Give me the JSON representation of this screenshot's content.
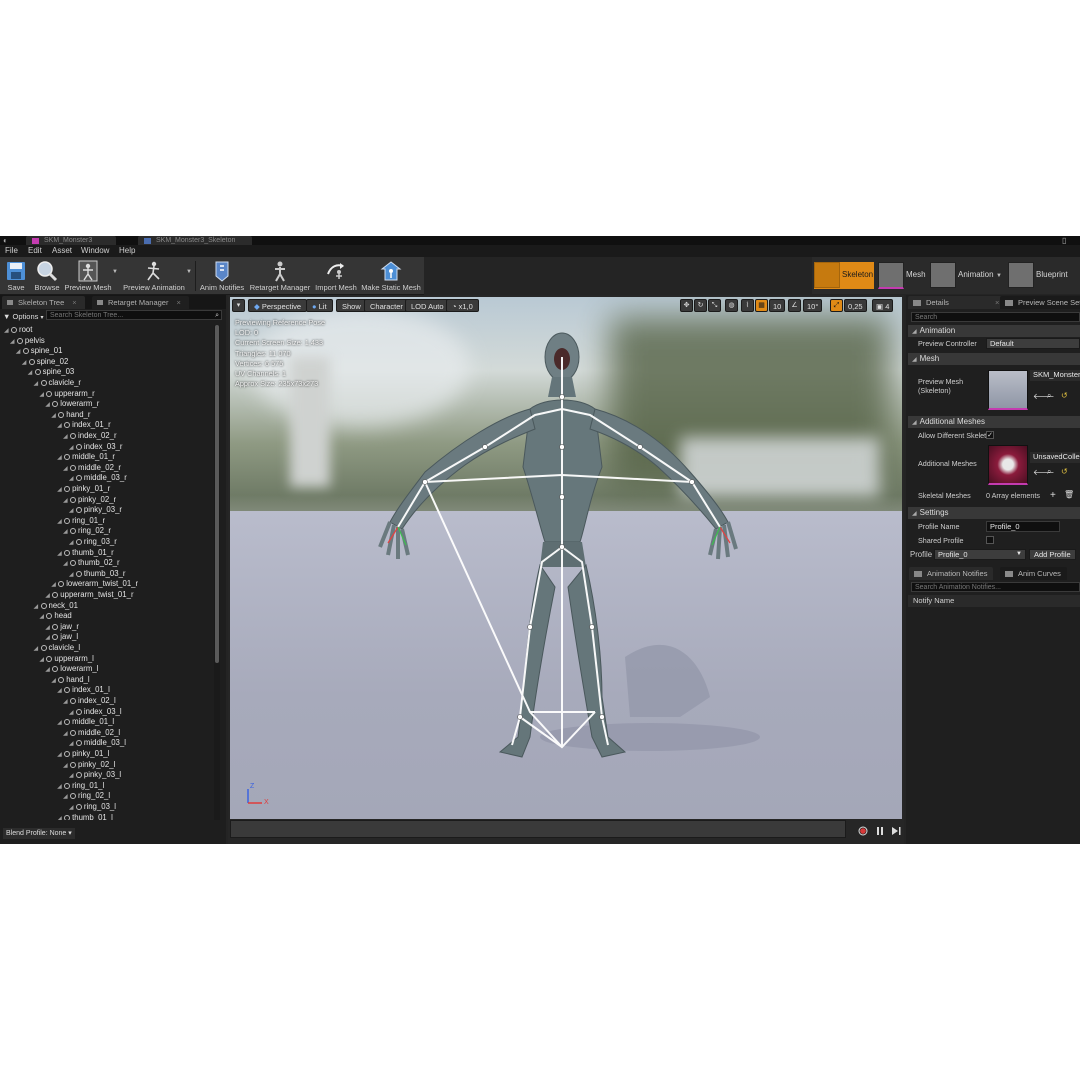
{
  "window": {
    "tabs": [
      {
        "label": "SKM_Monster3"
      },
      {
        "label": "SKM_Monster3_Skeleton"
      }
    ],
    "controls": "▯"
  },
  "menu": [
    "File",
    "Edit",
    "Asset",
    "Window",
    "Help"
  ],
  "toolbar": [
    {
      "label": "Save",
      "icon": "save-icon"
    },
    {
      "label": "Browse",
      "icon": "browse-icon"
    },
    {
      "label": "Preview Mesh",
      "icon": "preview-mesh-icon"
    },
    {
      "label": "Preview Animation",
      "icon": "preview-animation-icon"
    },
    {
      "label": "Anim Notifies",
      "icon": "anim-notifies-icon"
    },
    {
      "label": "Retarget Manager",
      "icon": "retarget-manager-icon"
    },
    {
      "label": "Import Mesh",
      "icon": "import-mesh-icon"
    },
    {
      "label": "Make Static Mesh",
      "icon": "make-static-mesh-icon"
    }
  ],
  "modes": [
    {
      "label": "Skeleton",
      "active": true
    },
    {
      "label": "Mesh",
      "active": false
    },
    {
      "label": "Animation",
      "active": false
    },
    {
      "label": "Blueprint",
      "active": false
    }
  ],
  "left_panel": {
    "tabs": [
      "Skeleton Tree",
      "Retarget Manager"
    ],
    "options_label": "Options",
    "search_placeholder": "Search Skeleton Tree...",
    "bones": [
      {
        "name": "root",
        "depth": 0
      },
      {
        "name": "pelvis",
        "depth": 1
      },
      {
        "name": "spine_01",
        "depth": 2
      },
      {
        "name": "spine_02",
        "depth": 3
      },
      {
        "name": "spine_03",
        "depth": 4
      },
      {
        "name": "clavicle_r",
        "depth": 5
      },
      {
        "name": "upperarm_r",
        "depth": 6
      },
      {
        "name": "lowerarm_r",
        "depth": 7
      },
      {
        "name": "hand_r",
        "depth": 8
      },
      {
        "name": "index_01_r",
        "depth": 9
      },
      {
        "name": "index_02_r",
        "depth": 10
      },
      {
        "name": "index_03_r",
        "depth": 11
      },
      {
        "name": "middle_01_r",
        "depth": 9
      },
      {
        "name": "middle_02_r",
        "depth": 10
      },
      {
        "name": "middle_03_r",
        "depth": 11
      },
      {
        "name": "pinky_01_r",
        "depth": 9
      },
      {
        "name": "pinky_02_r",
        "depth": 10
      },
      {
        "name": "pinky_03_r",
        "depth": 11
      },
      {
        "name": "ring_01_r",
        "depth": 9
      },
      {
        "name": "ring_02_r",
        "depth": 10
      },
      {
        "name": "ring_03_r",
        "depth": 11
      },
      {
        "name": "thumb_01_r",
        "depth": 9
      },
      {
        "name": "thumb_02_r",
        "depth": 10
      },
      {
        "name": "thumb_03_r",
        "depth": 11
      },
      {
        "name": "lowerarm_twist_01_r",
        "depth": 8
      },
      {
        "name": "upperarm_twist_01_r",
        "depth": 7
      },
      {
        "name": "neck_01",
        "depth": 5
      },
      {
        "name": "head",
        "depth": 6
      },
      {
        "name": "jaw_r",
        "depth": 7
      },
      {
        "name": "jaw_l",
        "depth": 7
      },
      {
        "name": "clavicle_l",
        "depth": 5
      },
      {
        "name": "upperarm_l",
        "depth": 6
      },
      {
        "name": "lowerarm_l",
        "depth": 7
      },
      {
        "name": "hand_l",
        "depth": 8
      },
      {
        "name": "index_01_l",
        "depth": 9
      },
      {
        "name": "index_02_l",
        "depth": 10
      },
      {
        "name": "index_03_l",
        "depth": 11
      },
      {
        "name": "middle_01_l",
        "depth": 9
      },
      {
        "name": "middle_02_l",
        "depth": 10
      },
      {
        "name": "middle_03_l",
        "depth": 11
      },
      {
        "name": "pinky_01_l",
        "depth": 9
      },
      {
        "name": "pinky_02_l",
        "depth": 10
      },
      {
        "name": "pinky_03_l",
        "depth": 11
      },
      {
        "name": "ring_01_l",
        "depth": 9
      },
      {
        "name": "ring_02_l",
        "depth": 10
      },
      {
        "name": "ring_03_l",
        "depth": 11
      },
      {
        "name": "thumb_01_l",
        "depth": 9
      }
    ],
    "blend_profile": "Blend Profile: None"
  },
  "viewport": {
    "buttons": {
      "perspective": "Perspective",
      "lit": "Lit",
      "show": "Show",
      "character": "Character",
      "lod": "LOD Auto",
      "speed": "x1,0"
    },
    "snap": {
      "grid": "10",
      "rotation": "10°",
      "scale": "0,25",
      "camera": "4"
    },
    "stats": [
      "Previewing Reference Pose",
      "LOD: 0",
      "Current Screen Size: 1,433",
      "Triangles: 11 070",
      "Vertices: 6 575",
      "UV Channels: 1",
      "Approx Size: 235x73x273"
    ],
    "axis": {
      "z": "Z",
      "x": "X"
    }
  },
  "right_panel": {
    "tabs": [
      "Details",
      "Preview Scene Sett"
    ],
    "search_placeholder": "Search",
    "sections": {
      "animation": "Animation",
      "mesh": "Mesh",
      "additional_meshes": "Additional Meshes",
      "settings": "Settings"
    },
    "props": {
      "preview_controller_label": "Preview Controller",
      "preview_controller_value": "Default",
      "preview_mesh_label": "Preview Mesh (Skeleton)",
      "preview_mesh_value": "SKM_Monster3",
      "allow_different_label": "Allow Different Skelet",
      "additional_meshes_label": "Additional Meshes",
      "additional_meshes_value": "UnsavedCollecti",
      "skeletal_meshes_label": "Skeletal Meshes",
      "skeletal_meshes_value": "0 Array elements",
      "profile_name_label": "Profile Name",
      "profile_name_value": "Profile_0",
      "shared_profile_label": "Shared Profile",
      "profile_label": "Profile",
      "profile_value": "Profile_0",
      "add_profile": "Add Profile"
    },
    "notifies": {
      "tabs": [
        "Animation Notifies",
        "Anim Curves"
      ],
      "search_placeholder": "Search Animation Notifies...",
      "column": "Notify Name"
    }
  },
  "colors": {
    "accent": "#e08a16",
    "panel": "#1e1e1e"
  }
}
